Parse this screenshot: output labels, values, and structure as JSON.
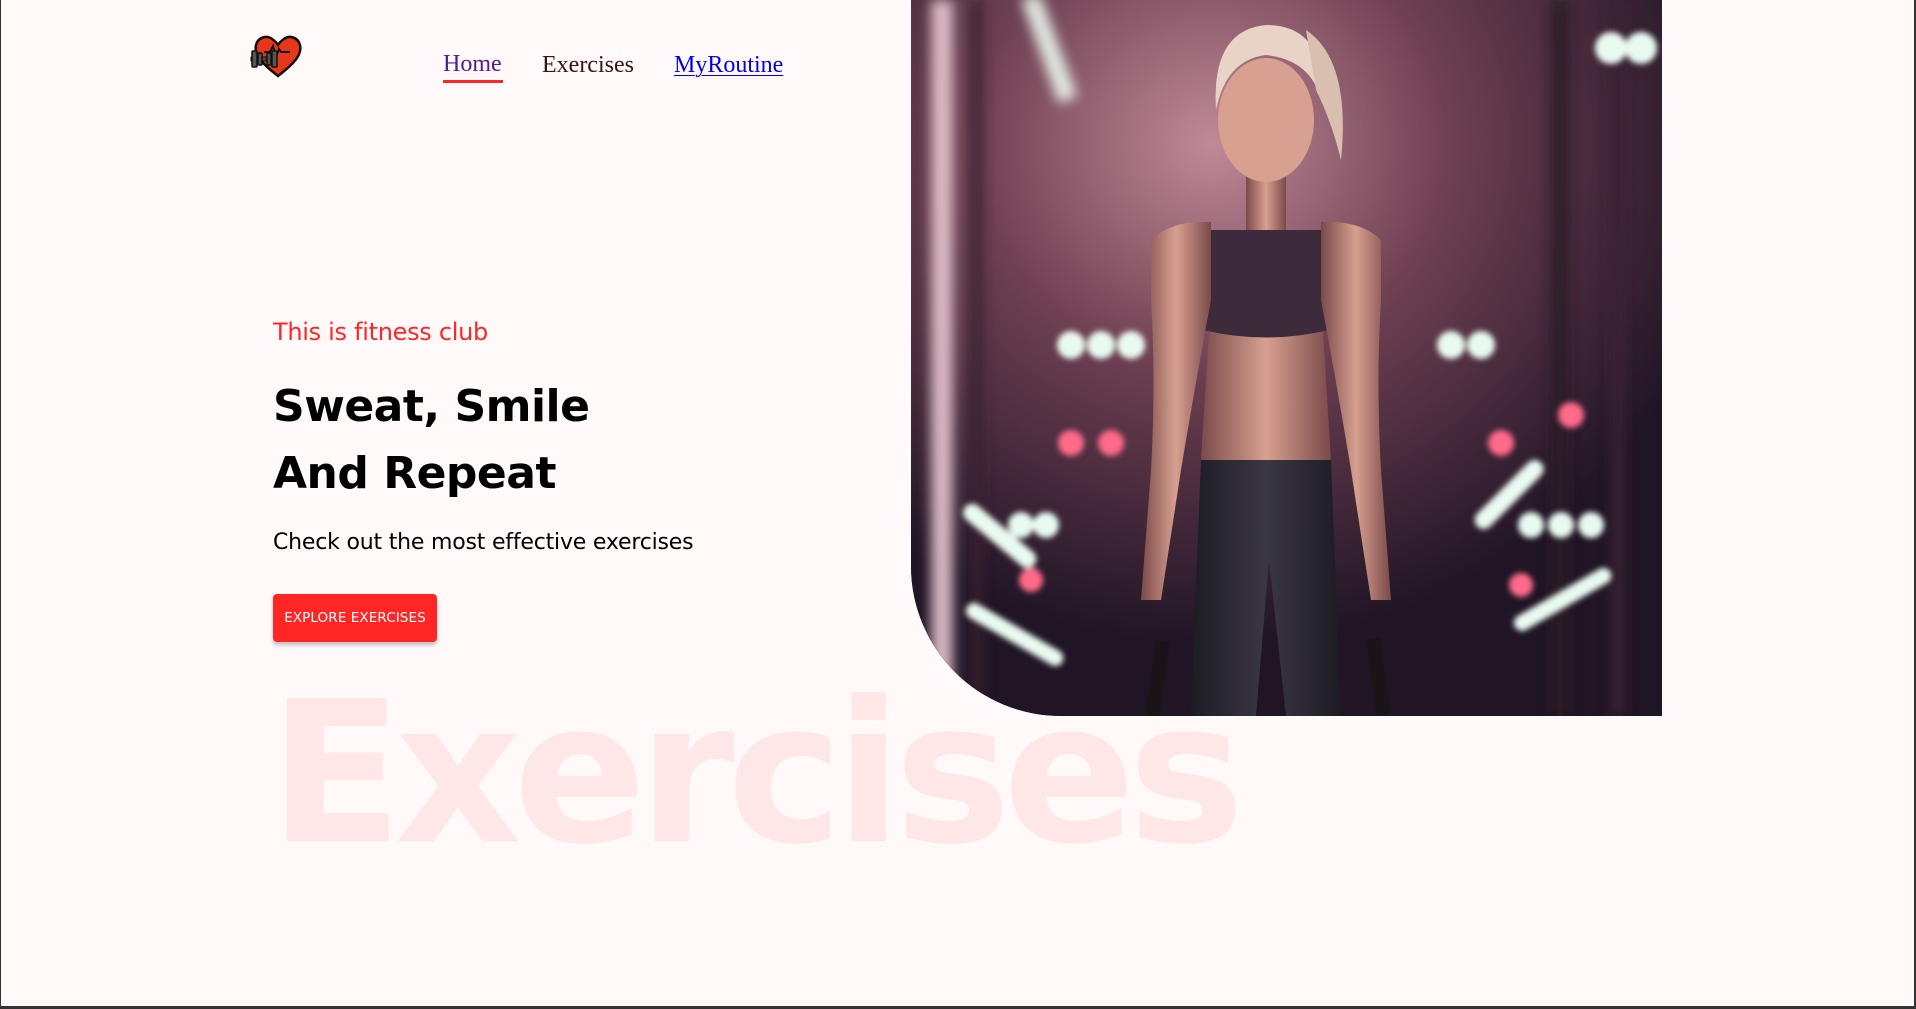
{
  "nav": {
    "home": "Home",
    "exercises": "Exercises",
    "routine": "MyRoutine"
  },
  "hero": {
    "tagline": "This is fitness club",
    "headline_line1": "Sweat, Smile",
    "headline_line2": "And Repeat",
    "subtext": "Check out the most effective exercises",
    "cta": "EXPLORE EXERCISES",
    "watermark": "Exercises"
  },
  "colors": {
    "accent": "#ff2625",
    "background": "#fff9fa"
  },
  "icons": {
    "logo": "heart-dumbbell-logo"
  }
}
